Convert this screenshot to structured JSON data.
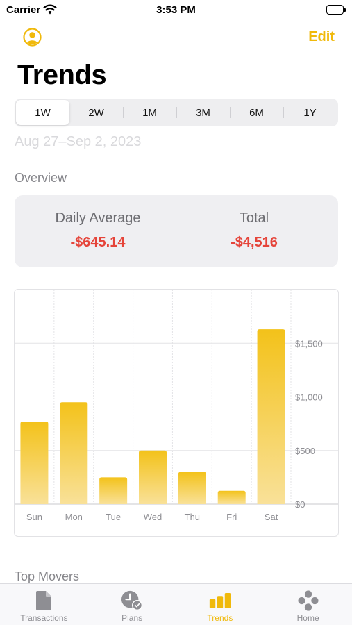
{
  "status_bar": {
    "carrier": "Carrier",
    "time": "3:53 PM",
    "wifi_icon": "wifi-icon",
    "battery_icon": "battery-icon"
  },
  "nav": {
    "profile_icon": "person-circle-icon",
    "edit_label": "Edit"
  },
  "title": "Trends",
  "periods": [
    "1W",
    "2W",
    "1M",
    "3M",
    "6M",
    "1Y"
  ],
  "selected_period": "1W",
  "date_range": "Aug 27–Sep 2, 2023",
  "overview": {
    "section_label": "Overview",
    "daily_average_label": "Daily Average",
    "daily_average_value": "-$645.14",
    "total_label": "Total",
    "total_value": "-$4,516"
  },
  "chart_data": {
    "type": "bar",
    "categories": [
      "Sun",
      "Mon",
      "Tue",
      "Wed",
      "Thu",
      "Fri",
      "Sat"
    ],
    "values": [
      770,
      950,
      250,
      500,
      300,
      125,
      1630
    ],
    "ylim": [
      0,
      2000
    ],
    "yticks": [
      0,
      500,
      1000,
      1500
    ],
    "ytick_labels": [
      "$0",
      "$500",
      "$1,000",
      "$1,500"
    ],
    "y_axis_position": "right",
    "grid": true,
    "bar_color_top": "#F3C21A",
    "bar_color_bottom": "#F9E199"
  },
  "top_movers_label": "Top Movers",
  "tab_bar": {
    "accent_color": "#F0B90B",
    "items": [
      {
        "label": "Transactions",
        "icon": "document-icon",
        "active": false
      },
      {
        "label": "Plans",
        "icon": "clock-check-icon",
        "active": false
      },
      {
        "label": "Trends",
        "icon": "bar-chart-icon",
        "active": true
      },
      {
        "label": "Home",
        "icon": "grid-dots-icon",
        "active": false
      }
    ]
  }
}
